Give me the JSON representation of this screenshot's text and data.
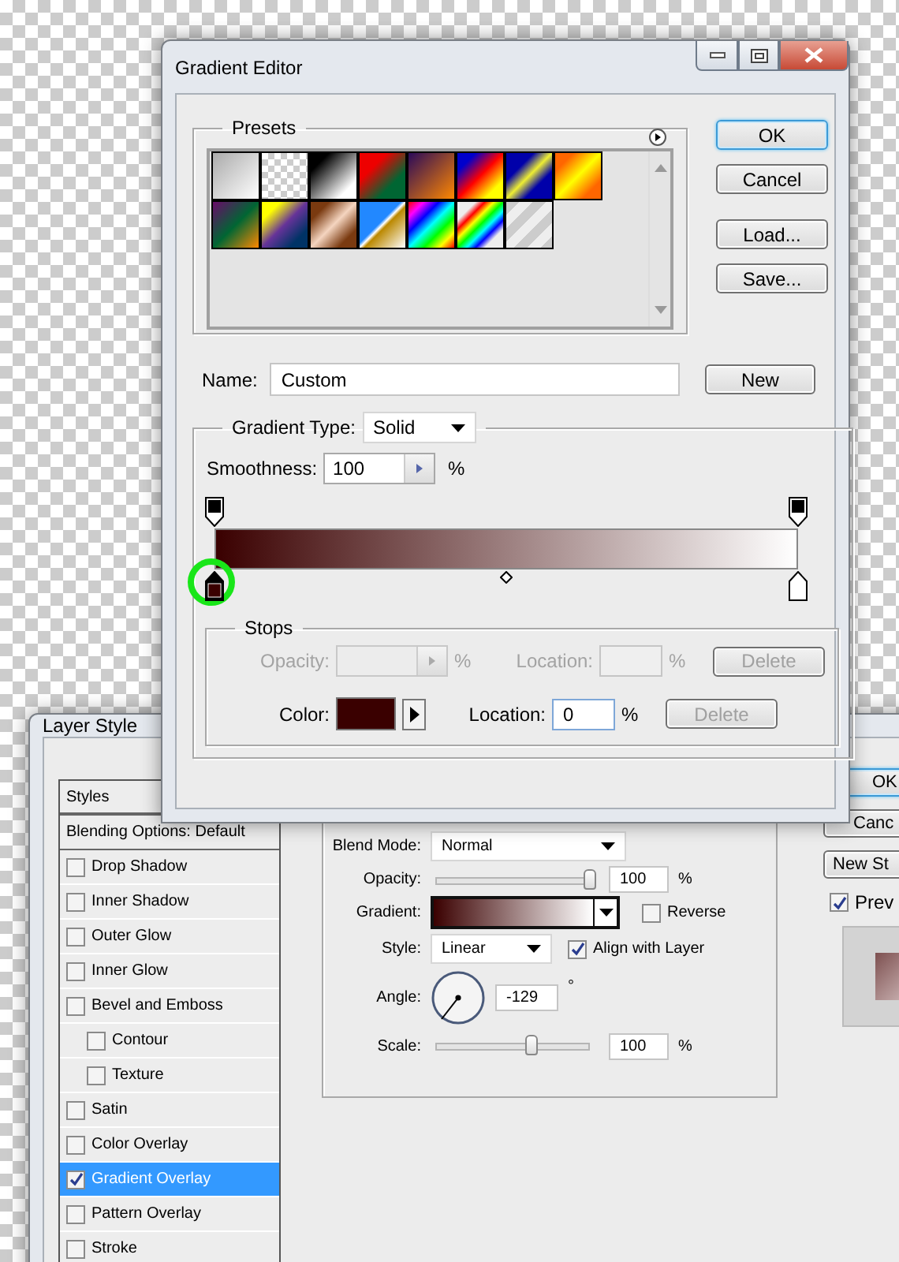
{
  "gradient_editor": {
    "title": "Gradient Editor",
    "presets": {
      "label": "Presets"
    },
    "buttons": [
      {
        "label": "OK",
        "default": true
      },
      {
        "label": "Cancel",
        "default": false
      },
      {
        "label": "Load...",
        "default": false
      },
      {
        "label": "Save...",
        "default": false
      }
    ],
    "name": {
      "label": "Name:",
      "value": "Custom"
    },
    "new_button": "New",
    "gradient_type": {
      "label": "Gradient Type:",
      "value": "Solid"
    },
    "smoothness": {
      "label": "Smoothness:",
      "value": "100",
      "unit": "%"
    },
    "opacity_stops": [
      {
        "selected": false
      },
      {
        "selected": false
      }
    ],
    "color_stops": [
      {
        "color": "#3a0000",
        "selected": true
      },
      {
        "color": "#ffffff",
        "selected": false
      }
    ],
    "stops": {
      "label": "Stops",
      "opacity": {
        "label": "Opacity:",
        "unit": "%",
        "location_label": "Location:",
        "location_unit": "%",
        "delete": "Delete",
        "disabled": true
      },
      "color": {
        "label": "Color:",
        "location_label": "Location:",
        "location_value": "0",
        "location_unit": "%",
        "delete": "Delete",
        "delete_disabled": true
      }
    }
  },
  "layer_style": {
    "title": "Layer Style",
    "styles_header": "Styles",
    "blending_options": "Blending Options: Default",
    "effects": [
      {
        "label": "Drop Shadow",
        "checked": false,
        "selected": false
      },
      {
        "label": "Inner Shadow",
        "checked": false,
        "selected": false
      },
      {
        "label": "Outer Glow",
        "checked": false,
        "selected": false
      },
      {
        "label": "Inner Glow",
        "checked": false,
        "selected": false
      },
      {
        "label": "Bevel and Emboss",
        "checked": false,
        "selected": false,
        "children": [
          {
            "label": "Contour",
            "checked": false,
            "selected": false
          },
          {
            "label": "Texture",
            "checked": false,
            "selected": false
          }
        ]
      },
      {
        "label": "Satin",
        "checked": false,
        "selected": false
      },
      {
        "label": "Color Overlay",
        "checked": false,
        "selected": false
      },
      {
        "label": "Gradient Overlay",
        "checked": true,
        "selected": true
      },
      {
        "label": "Pattern Overlay",
        "checked": false,
        "selected": false
      },
      {
        "label": "Stroke",
        "checked": false,
        "selected": false
      }
    ],
    "gradient_overlay": {
      "blend_mode": {
        "label": "Blend Mode:",
        "value": "Normal"
      },
      "opacity": {
        "label": "Opacity:",
        "level": 1,
        "value": "100",
        "unit": "%"
      },
      "gradient": {
        "label": "Gradient:"
      },
      "reverse": {
        "label": "Reverse",
        "checked": false
      },
      "style": {
        "label": "Style:",
        "value": "Linear"
      },
      "align": {
        "label": "Align with Layer",
        "checked": true
      },
      "angle": {
        "label": "Angle:",
        "value": "-129",
        "unit": "°"
      },
      "scale": {
        "label": "Scale:",
        "level": 0.62,
        "value": "100",
        "unit": "%"
      }
    },
    "buttons": [
      {
        "label": "OK",
        "default": true
      },
      {
        "label": "Canc",
        "default": false
      },
      {
        "label": "New St",
        "default": false
      }
    ],
    "preview": {
      "label": "Prev",
      "checked": true
    }
  }
}
